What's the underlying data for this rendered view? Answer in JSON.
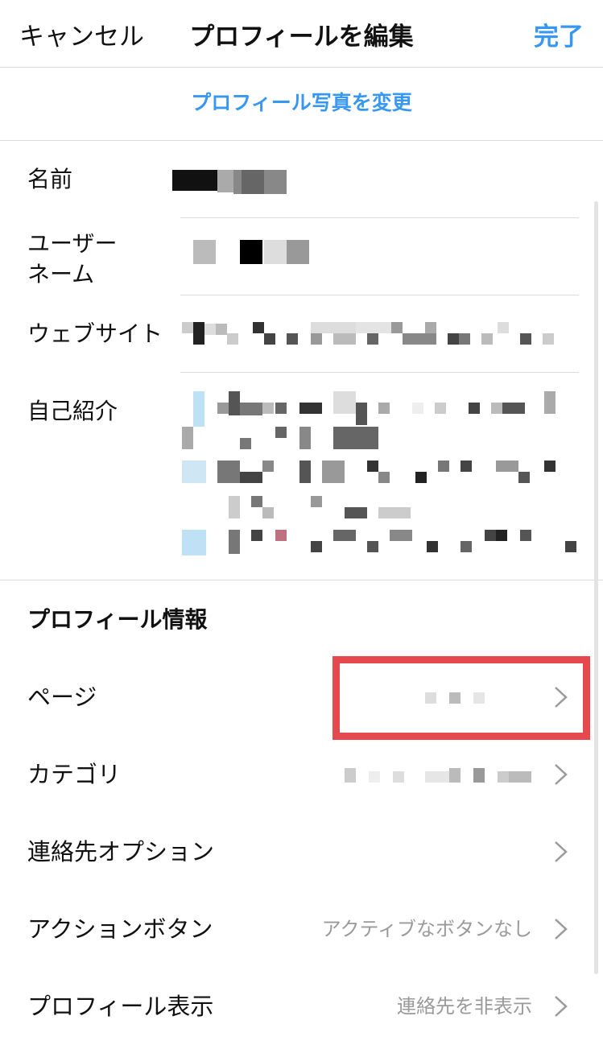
{
  "nav": {
    "cancel_label": "キャンセル",
    "title": "プロフィールを編集",
    "done_label": "完了"
  },
  "change_photo_label": "プロフィール写真を変更",
  "fields": {
    "name_label": "名前",
    "username_label_line1": "ユーザー",
    "username_label_line2": "ネーム",
    "website_label": "ウェブサイト",
    "bio_label": "自己紹介"
  },
  "profile_info": {
    "section_title": "プロフィール情報",
    "rows": [
      {
        "label": "ページ",
        "value": "",
        "icon": "chevron-right-icon"
      },
      {
        "label": "カテゴリ",
        "value": "",
        "icon": "chevron-right-icon"
      },
      {
        "label": "連絡先オプション",
        "value": "",
        "icon": "chevron-right-icon"
      },
      {
        "label": "アクションボタン",
        "value": "アクティブなボタンなし",
        "icon": "chevron-right-icon"
      },
      {
        "label": "プロフィール表示",
        "value": "連絡先を非表示",
        "icon": "chevron-right-icon"
      }
    ]
  },
  "colors": {
    "accent": "#3897f0",
    "highlight": "#e5484d",
    "divider": "#dbdbdb",
    "secondary_text": "#9a9a9a"
  }
}
